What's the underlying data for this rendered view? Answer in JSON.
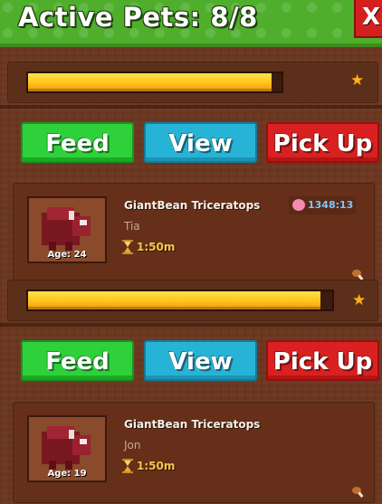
{
  "header": {
    "title": "Active Pets: 8/8",
    "close_label": "X"
  },
  "pets": [
    {
      "progress": 0.96,
      "buttons": {
        "feed": "Feed",
        "view": "View",
        "pick_up": "Pick Up"
      },
      "species": "GiantBean Triceratops",
      "owner": "Tia",
      "age": "Age: 24",
      "timer": "1:50m",
      "iq": "1348:13"
    },
    {
      "progress": 0.96,
      "buttons": {
        "feed": "Feed",
        "view": "View",
        "pick_up": "Pick Up"
      },
      "species": "GiantBean Triceratops",
      "owner": "Jon",
      "age": "Age: 19",
      "timer": "1:50m"
    }
  ],
  "colors": {
    "header_green": "#4fae2c",
    "feed": "#2fd13a",
    "view": "#27b3d6",
    "pick_up": "#d92121",
    "progress": "#ffc21a"
  }
}
